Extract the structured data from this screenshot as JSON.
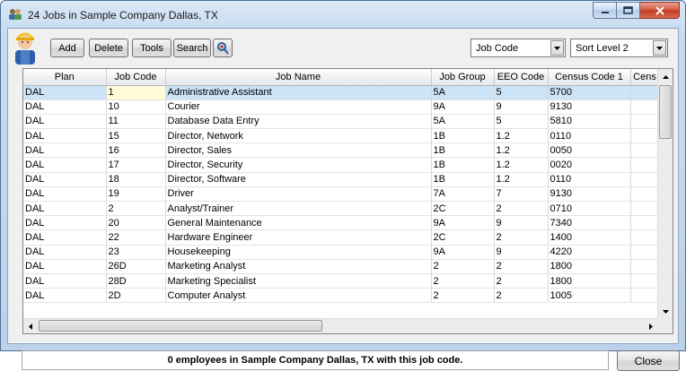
{
  "window": {
    "title": "24 Jobs in Sample Company Dallas, TX"
  },
  "toolbar": {
    "add_label": "Add",
    "delete_label": "Delete",
    "tools_label": "Tools",
    "search_label": "Search",
    "people_icon": "people-search-icon",
    "sort_field": "Job Code",
    "sort_level": "Sort Level 2"
  },
  "grid": {
    "columns": [
      "Plan",
      "Job Code",
      "Job Name",
      "Job Group",
      "EEO Code",
      "Census Code 1",
      "Cens"
    ],
    "rows": [
      [
        "DAL",
        "1",
        "Administrative Assistant",
        "5A",
        "5",
        "5700",
        ""
      ],
      [
        "DAL",
        "10",
        "Courier",
        "9A",
        "9",
        "9130",
        ""
      ],
      [
        "DAL",
        "11",
        "Database Data Entry",
        "5A",
        "5",
        "5810",
        ""
      ],
      [
        "DAL",
        "15",
        "Director, Network",
        "1B",
        "1.2",
        "0110",
        ""
      ],
      [
        "DAL",
        "16",
        "Director, Sales",
        "1B",
        "1.2",
        "0050",
        ""
      ],
      [
        "DAL",
        "17",
        "Director, Security",
        "1B",
        "1.2",
        "0020",
        ""
      ],
      [
        "DAL",
        "18",
        "Director, Software",
        "1B",
        "1.2",
        "0110",
        ""
      ],
      [
        "DAL",
        "19",
        "Driver",
        "7A",
        "7",
        "9130",
        ""
      ],
      [
        "DAL",
        "2",
        "Analyst/Trainer",
        "2C",
        "2",
        "0710",
        ""
      ],
      [
        "DAL",
        "20",
        "General Maintenance",
        "9A",
        "9",
        "7340",
        ""
      ],
      [
        "DAL",
        "22",
        "Hardware Engineer",
        "2C",
        "2",
        "1400",
        ""
      ],
      [
        "DAL",
        "23",
        "Housekeeping",
        "9A",
        "9",
        "4220",
        ""
      ],
      [
        "DAL",
        "26D",
        "Marketing Analyst",
        "2",
        "2",
        "1800",
        ""
      ],
      [
        "DAL",
        "28D",
        "Marketing Specialist",
        "2",
        "2",
        "1800",
        ""
      ],
      [
        "DAL",
        "2D",
        "Computer Analyst",
        "2",
        "2",
        "1005",
        ""
      ]
    ],
    "selected_row": 0
  },
  "status": {
    "text": "0 employees in Sample Company Dallas, TX with this job code."
  },
  "close_label": "Close",
  "colors": {
    "selection": "#cce4f7",
    "active_cell": "#fffcd8",
    "close_red": "#c13d22"
  }
}
